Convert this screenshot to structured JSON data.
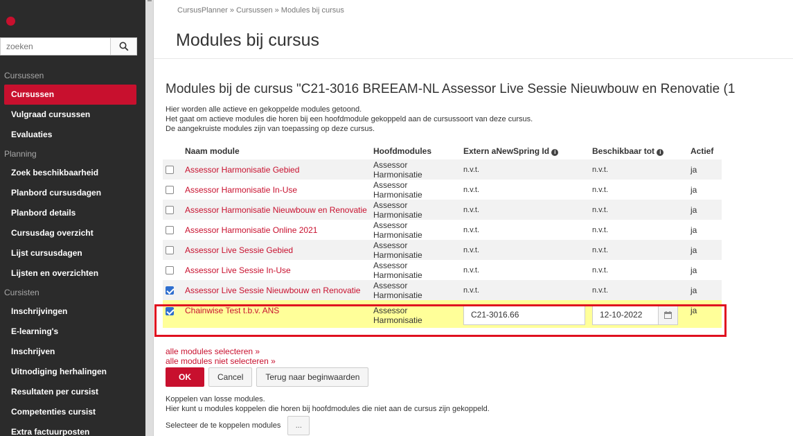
{
  "sidebar": {
    "search_placeholder": "zoeken",
    "sections": [
      {
        "title": "Cursussen",
        "items": [
          {
            "label": "Cursussen",
            "active": true
          },
          {
            "label": "Vulgraad cursussen"
          },
          {
            "label": "Evaluaties"
          }
        ]
      },
      {
        "title": "Planning",
        "items": [
          {
            "label": "Zoek beschikbaarheid"
          },
          {
            "label": "Planbord cursusdagen"
          },
          {
            "label": "Planbord details"
          },
          {
            "label": "Cursusdag overzicht"
          },
          {
            "label": "Lijst cursusdagen"
          },
          {
            "label": "Lijsten en overzichten"
          }
        ]
      },
      {
        "title": "Cursisten",
        "items": [
          {
            "label": "Inschrijvingen"
          },
          {
            "label": "E-learning's"
          },
          {
            "label": "Inschrijven"
          },
          {
            "label": "Uitnodiging herhalingen"
          },
          {
            "label": "Resultaten per cursist"
          },
          {
            "label": "Competenties cursist"
          },
          {
            "label": "Extra factuurposten"
          }
        ]
      }
    ]
  },
  "breadcrumb": "CursusPlanner » Cursussen » Modules bij cursus",
  "page_title": "Modules bij cursus",
  "sub_title": "Modules bij de cursus \"C21-3016 BREEAM-NL Assessor Live Sessie Nieuwbouw en Renovatie (1",
  "intro": [
    "Hier worden alle actieve en gekoppelde modules getoond.",
    "Het gaat om actieve modules die horen bij een hoofdmodule gekoppeld aan de cursussoort van deze cursus.",
    "De aangekruiste modules zijn van toepassing op deze cursus."
  ],
  "table": {
    "headers": {
      "name": "Naam module",
      "main": "Hoofdmodules",
      "extern": "Extern aNewSpring Id",
      "until": "Beschikbaar tot",
      "active": "Actief"
    },
    "rows": [
      {
        "checked": false,
        "name": "Assessor Harmonisatie Gebied",
        "main": "Assessor Harmonisatie",
        "extern": "n.v.t.",
        "until": "n.v.t.",
        "active": "ja"
      },
      {
        "checked": false,
        "name": "Assessor Harmonisatie In-Use",
        "main": "Assessor Harmonisatie",
        "extern": "n.v.t.",
        "until": "n.v.t.",
        "active": "ja"
      },
      {
        "checked": false,
        "name": "Assessor Harmonisatie Nieuwbouw en Renovatie",
        "main": "Assessor Harmonisatie",
        "extern": "n.v.t.",
        "until": "n.v.t.",
        "active": "ja"
      },
      {
        "checked": false,
        "name": "Assessor Harmonisatie Online 2021",
        "main": "Assessor Harmonisatie",
        "extern": "n.v.t.",
        "until": "n.v.t.",
        "active": "ja"
      },
      {
        "checked": false,
        "name": "Assessor Live Sessie Gebied",
        "main": "Assessor Harmonisatie",
        "extern": "n.v.t.",
        "until": "n.v.t.",
        "active": "ja"
      },
      {
        "checked": false,
        "name": "Assessor Live Sessie In-Use",
        "main": "Assessor Harmonisatie",
        "extern": "n.v.t.",
        "until": "n.v.t.",
        "active": "ja"
      },
      {
        "checked": true,
        "name": "Assessor Live Sessie Nieuwbouw en Renovatie",
        "main": "Assessor Harmonisatie",
        "extern": "n.v.t.",
        "until": "n.v.t.",
        "active": "ja"
      }
    ],
    "highlight_row": {
      "checked": true,
      "name": "Chainwise Test t.b.v. ANS",
      "main": "Assessor Harmonisatie",
      "extern_value": "C21-3016.66",
      "until_value": "12-10-2022",
      "active": "ja"
    }
  },
  "links": {
    "select_all": "alle modules selecteren »",
    "deselect_all": "alle modules niet selecteren »"
  },
  "buttons": {
    "ok": "OK",
    "cancel": "Cancel",
    "reset": "Terug naar beginwaarden",
    "dots": "..."
  },
  "couple": {
    "line1": "Koppelen van losse modules.",
    "line2": "Hier kunt u modules koppelen die horen bij hoofdmodules die niet aan de cursus zijn gekoppeld.",
    "select_label": "Selecteer de te koppelen modules"
  },
  "colors": {
    "accent": "#c8102e",
    "sidebar": "#2b2b2b",
    "highlight": "#ffff99"
  }
}
